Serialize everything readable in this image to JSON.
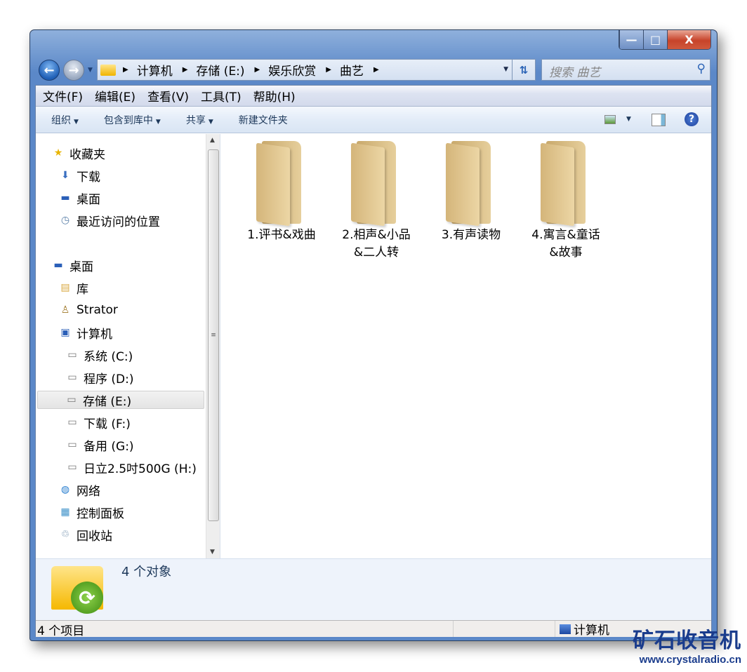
{
  "window": {
    "controls": {
      "minimize": "—",
      "maximize": "□",
      "close": "X"
    }
  },
  "address": {
    "crumbs": [
      "计算机",
      "存储 (E:)",
      "娱乐欣赏",
      "曲艺"
    ],
    "search_placeholder": "搜索 曲艺"
  },
  "menu": [
    "文件(F)",
    "编辑(E)",
    "查看(V)",
    "工具(T)",
    "帮助(H)"
  ],
  "toolbar": {
    "organize": "组织",
    "include": "包含到库中",
    "share": "共享",
    "new_folder": "新建文件夹"
  },
  "nav": [
    {
      "label": "收藏夹",
      "icon": "star-icon",
      "indent": 0
    },
    {
      "label": "下载",
      "icon": "downloads-icon",
      "indent": 1
    },
    {
      "label": "桌面",
      "icon": "desktop-icon",
      "indent": 1
    },
    {
      "label": "最近访问的位置",
      "icon": "recent-places-icon",
      "indent": 1
    },
    {
      "label": "桌面",
      "icon": "desktop-icon",
      "indent": 0
    },
    {
      "label": "库",
      "icon": "libraries-icon",
      "indent": 1
    },
    {
      "label": "Strator",
      "icon": "user-icon",
      "indent": 1
    },
    {
      "label": "计算机",
      "icon": "computer-icon",
      "indent": 1
    },
    {
      "label": "系统 (C:)",
      "icon": "drive-icon",
      "indent": 2
    },
    {
      "label": "程序 (D:)",
      "icon": "drive-icon",
      "indent": 2
    },
    {
      "label": "存储 (E:)",
      "icon": "drive-icon",
      "indent": 2,
      "selected": true
    },
    {
      "label": "下载 (F:)",
      "icon": "drive-icon",
      "indent": 2
    },
    {
      "label": "备用 (G:)",
      "icon": "drive-icon",
      "indent": 2
    },
    {
      "label": "日立2.5吋500G (H:)",
      "icon": "drive-icon",
      "indent": 2
    },
    {
      "label": "网络",
      "icon": "network-icon",
      "indent": 1
    },
    {
      "label": "控制面板",
      "icon": "control-panel-icon",
      "indent": 1
    },
    {
      "label": "回收站",
      "icon": "recycle-bin-icon",
      "indent": 1
    }
  ],
  "folders": [
    {
      "line1": "1.评书&戏曲",
      "line2": ""
    },
    {
      "line1": "2.相声&小品",
      "line2": "&二人转"
    },
    {
      "line1": "3.有声读物",
      "line2": ""
    },
    {
      "line1": "4.寓言&童话",
      "line2": "&故事"
    }
  ],
  "details": {
    "count": "4 个对象"
  },
  "status": {
    "items": "4 个项目",
    "location": "计算机"
  },
  "watermark": {
    "title": "矿石收音机",
    "url": "www.crystalradio.cn"
  }
}
